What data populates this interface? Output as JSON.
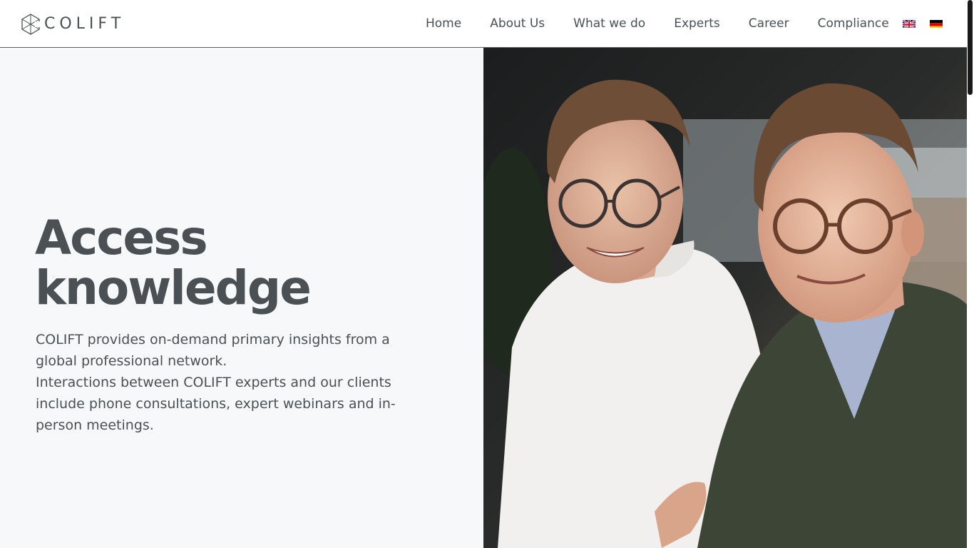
{
  "brand": {
    "name": "COLIFT",
    "logo_icon": "colift-logo-icon"
  },
  "nav": {
    "items": [
      {
        "label": "Home"
      },
      {
        "label": "About Us"
      },
      {
        "label": "What we do"
      },
      {
        "label": "Experts"
      },
      {
        "label": "Career"
      },
      {
        "label": "Compliance"
      }
    ],
    "languages": [
      {
        "icon": "uk-flag-icon"
      },
      {
        "icon": "german-flag-icon"
      }
    ]
  },
  "hero": {
    "title_line1": "Access",
    "title_line2": "knowledge",
    "paragraph1": "COLIFT provides on-demand primary insights from a global professional network.",
    "paragraph2": "Interactions between COLIFT experts and our clients include phone consultations, expert webinars and in-person meetings.",
    "image": "two-smiling-men-with-glasses-photo"
  },
  "colors": {
    "text": "#4a5053",
    "hero_background": "#f6f8fa",
    "header_border": "#5a5f61"
  }
}
